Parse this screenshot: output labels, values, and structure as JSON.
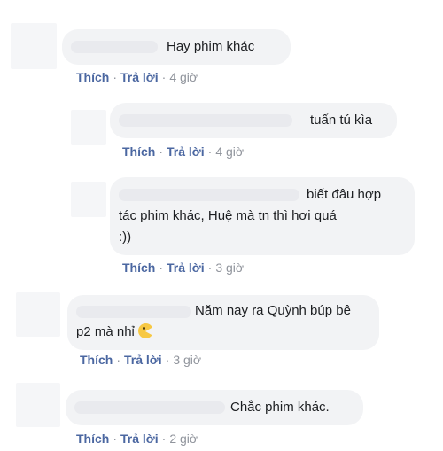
{
  "actions": {
    "like_label": "Thích",
    "reply_label": "Trả lời",
    "separator": "·"
  },
  "comments": [
    {
      "text": "Hay phim khác",
      "time": "4 giờ"
    },
    {
      "text": "tuấn tú kìa",
      "time": "4 giờ"
    },
    {
      "text_line1": "biết đâu hợp",
      "text_line2": "tác phim khác, Huệ mà tn thì hơi quá",
      "text_line3": ":))",
      "time": "3 giờ"
    },
    {
      "text_line1": "Năm nay ra Quỳnh búp bê",
      "text_line2": "p2 mà nhỉ",
      "emoji": "pacman-emoji",
      "time": "3 giờ"
    },
    {
      "text": "Chắc phim khác.",
      "time": "2 giờ"
    }
  ]
}
